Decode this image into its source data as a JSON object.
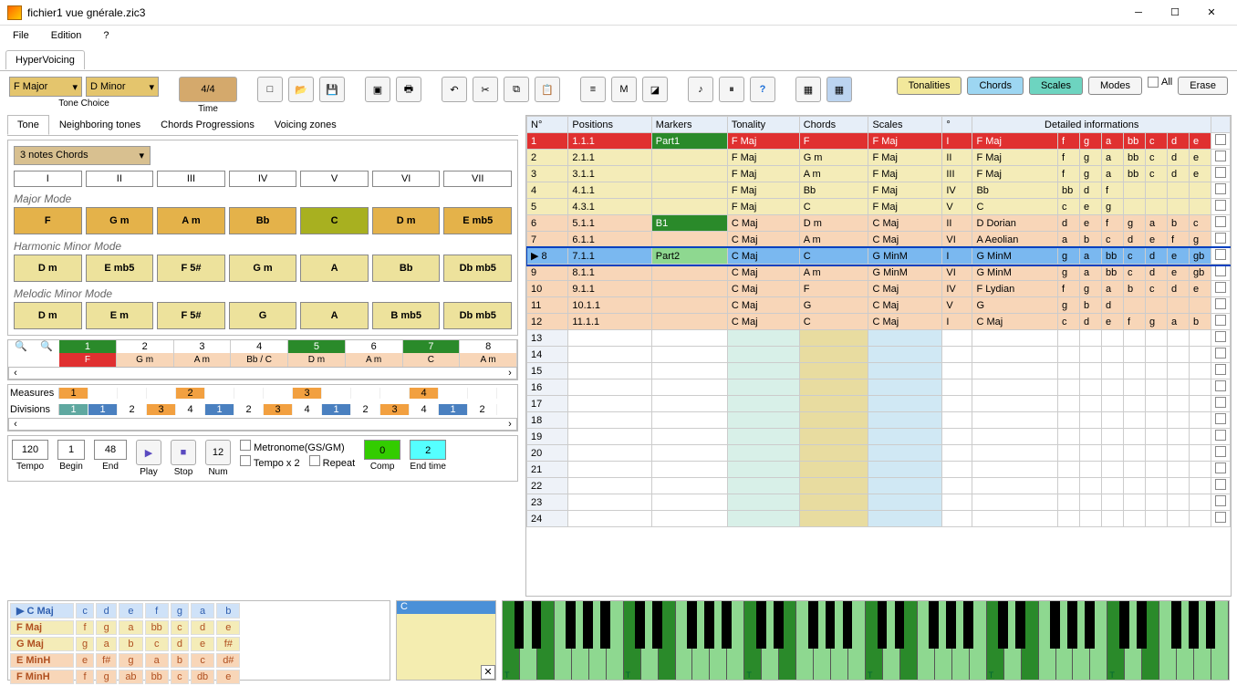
{
  "window": {
    "title": "fichier1 vue gnérale.zic3"
  },
  "menu": {
    "file": "File",
    "edition": "Edition",
    "help": "?"
  },
  "apptab": "HyperVoicing",
  "tonechoice": {
    "key": "F Major",
    "rel": "D Minor",
    "label": "Tone Choice"
  },
  "time": {
    "sig": "4/4",
    "label": "Time"
  },
  "viewbtns": {
    "tonalities": "Tonalities",
    "chords": "Chords",
    "scales": "Scales",
    "modes": "Modes",
    "all": "All",
    "erase": "Erase"
  },
  "subtabs": {
    "tone": "Tone",
    "neigh": "Neighboring tones",
    "prog": "Chords Progressions",
    "voic": "Voicing zones"
  },
  "chordsel": "3 notes Chords",
  "degrees": [
    "I",
    "II",
    "III",
    "IV",
    "V",
    "VI",
    "VII"
  ],
  "modes": {
    "major": {
      "label": "Major Mode",
      "chords": [
        "F",
        "G m",
        "A m",
        "Bb",
        "C",
        "D m",
        "E mb5"
      ],
      "highlight": 4
    },
    "harm": {
      "label": "Harmonic Minor Mode",
      "chords": [
        "D m",
        "E mb5",
        "F 5#",
        "G m",
        "A",
        "Bb",
        "Db mb5"
      ]
    },
    "mel": {
      "label": "Melodic Minor Mode",
      "chords": [
        "D m",
        "E m",
        "F 5#",
        "G",
        "A",
        "B mb5",
        "Db mb5"
      ]
    }
  },
  "track": {
    "nums": [
      "1",
      "2",
      "3",
      "4",
      "5",
      "6",
      "7",
      "8"
    ],
    "hl": [
      0,
      4,
      6
    ],
    "chords": [
      "F",
      "G m",
      "A m",
      "Bb / C",
      "D m",
      "A m",
      "C",
      "A m"
    ]
  },
  "meas": {
    "label_m": "Measures",
    "label_d": "Divisions",
    "mcells": [
      "1",
      "",
      "",
      "",
      "2",
      "",
      "",
      "",
      "3",
      "",
      "",
      "",
      "4",
      "",
      ""
    ],
    "dcells": [
      "1",
      "1",
      "2",
      "3",
      "4",
      "1",
      "2",
      "3",
      "4",
      "1",
      "2",
      "3",
      "4",
      "1",
      "2"
    ],
    "mcolor": [
      true,
      false,
      false,
      false,
      true,
      false,
      false,
      false,
      true,
      false,
      false,
      false,
      true,
      false,
      false
    ]
  },
  "transport": {
    "tempo": "120",
    "tempo_l": "Tempo",
    "begin": "1",
    "begin_l": "Begin",
    "end": "48",
    "end_l": "End",
    "play_l": "Play",
    "stop_l": "Stop",
    "num": "12",
    "num_l": "Num",
    "metro": "Metronome(GS/GM)",
    "tx2": "Tempo x 2",
    "rep": "Repeat",
    "comp": "0",
    "comp_l": "Comp",
    "endtime": "2",
    "endtime_l": "End time"
  },
  "grid": {
    "headers": [
      "N°",
      "Positions",
      "Markers",
      "Tonality",
      "Chords",
      "Scales",
      "°"
    ],
    "detail_h": "Detailed informations",
    "rows": [
      {
        "n": "1",
        "pos": "1.1.1",
        "mark": "Part1",
        "mark_c": "green",
        "ton": "F Maj",
        "ch": "F",
        "sc": "F Maj",
        "deg": "I",
        "cls": "row-red",
        "d": {
          "name": "F Maj",
          "notes": [
            "f",
            "g",
            "a",
            "bb",
            "c",
            "d",
            "e"
          ],
          "c": "detail-yellow"
        }
      },
      {
        "n": "2",
        "pos": "2.1.1",
        "mark": "",
        "ton": "F Maj",
        "ch": "G m",
        "sc": "F Maj",
        "deg": "II",
        "cls": "row-cream",
        "d": {
          "name": "F Maj",
          "notes": [
            "f",
            "g",
            "a",
            "bb",
            "c",
            "d",
            "e"
          ],
          "c": "detail-yellow"
        }
      },
      {
        "n": "3",
        "pos": "3.1.1",
        "mark": "",
        "ton": "F Maj",
        "ch": "A m",
        "sc": "F Maj",
        "deg": "III",
        "cls": "row-cream",
        "d": {
          "name": "F Maj",
          "notes": [
            "f",
            "g",
            "a",
            "bb",
            "c",
            "d",
            "e"
          ],
          "c": "detail-yellow"
        }
      },
      {
        "n": "4",
        "pos": "4.1.1",
        "mark": "",
        "ton": "F Maj",
        "ch": "Bb",
        "sc": "F Maj",
        "deg": "IV",
        "cls": "row-cream",
        "d": {
          "name": "Bb",
          "notes": [
            "bb",
            "d",
            "f",
            "",
            "",
            "",
            ""
          ],
          "c": "detail-blue"
        }
      },
      {
        "n": "5",
        "pos": "4.3.1",
        "mark": "",
        "ton": "F Maj",
        "ch": "C",
        "sc": "F Maj",
        "deg": "V",
        "cls": "row-cream",
        "d": {
          "name": "C",
          "notes": [
            "c",
            "e",
            "g",
            "",
            "",
            "",
            ""
          ],
          "c": "detail-blue"
        }
      },
      {
        "n": "6",
        "pos": "5.1.1",
        "mark": "B1",
        "mark_c": "green",
        "ton": "C Maj",
        "ch": "D m",
        "sc": "C Maj",
        "deg": "II",
        "cls": "row-peach",
        "d": {
          "name": "D Dorian",
          "notes": [
            "d",
            "e",
            "f",
            "g",
            "a",
            "b",
            "c"
          ],
          "c": ""
        }
      },
      {
        "n": "7",
        "pos": "6.1.1",
        "mark": "",
        "ton": "C Maj",
        "ch": "A m",
        "sc": "C Maj",
        "deg": "VI",
        "cls": "row-peach",
        "d": {
          "name": "A Aeolian",
          "notes": [
            "a",
            "b",
            "c",
            "d",
            "e",
            "f",
            "g"
          ],
          "c": ""
        }
      },
      {
        "n": "8",
        "pos": "7.1.1",
        "mark": "Part2",
        "mark_c": "lgreen",
        "ton": "C Maj",
        "ch": "C",
        "sc": "G MinM",
        "deg": "I",
        "cls": "row-blue",
        "sel": true,
        "d": {
          "name": "G MinM",
          "notes": [
            "g",
            "a",
            "bb",
            "c",
            "d",
            "e",
            "gb"
          ],
          "c": "detail-teal"
        }
      },
      {
        "n": "9",
        "pos": "8.1.1",
        "mark": "",
        "ton": "C Maj",
        "ch": "A m",
        "sc": "G MinM",
        "deg": "VI",
        "cls": "row-peach",
        "d": {
          "name": "G MinM",
          "notes": [
            "g",
            "a",
            "bb",
            "c",
            "d",
            "e",
            "gb"
          ],
          "c": "detail-teal"
        }
      },
      {
        "n": "10",
        "pos": "9.1.1",
        "mark": "",
        "ton": "C Maj",
        "ch": "F",
        "sc": "C Maj",
        "deg": "IV",
        "cls": "row-peach",
        "d": {
          "name": "F Lydian",
          "notes": [
            "f",
            "g",
            "a",
            "b",
            "c",
            "d",
            "e"
          ],
          "c": ""
        }
      },
      {
        "n": "11",
        "pos": "10.1.1",
        "mark": "",
        "ton": "C Maj",
        "ch": "G",
        "sc": "C Maj",
        "deg": "V",
        "cls": "row-peach",
        "d": {
          "name": "G",
          "notes": [
            "g",
            "b",
            "d",
            "",
            "",
            "",
            ""
          ],
          "c": "detail-ltblue"
        }
      },
      {
        "n": "12",
        "pos": "11.1.1",
        "mark": "",
        "ton": "C Maj",
        "ch": "C",
        "sc": "C Maj",
        "deg": "I",
        "cls": "row-peach",
        "d": {
          "name": "C Maj",
          "notes": [
            "c",
            "d",
            "e",
            "f",
            "g",
            "a",
            "b"
          ],
          "c": "detail-teal"
        }
      }
    ],
    "empty": [
      "13",
      "14",
      "15",
      "16",
      "17",
      "18",
      "19",
      "20",
      "21",
      "22",
      "23",
      "24"
    ]
  },
  "scales": [
    {
      "name": "C Maj",
      "notes": [
        "c",
        "d",
        "e",
        "f",
        "g",
        "a",
        "b"
      ],
      "cls": "sc-blue"
    },
    {
      "name": "F Maj",
      "notes": [
        "f",
        "g",
        "a",
        "bb",
        "c",
        "d",
        "e"
      ],
      "cls": "sc-yel"
    },
    {
      "name": "G Maj",
      "notes": [
        "g",
        "a",
        "b",
        "c",
        "d",
        "e",
        "f#"
      ],
      "cls": "sc-yel"
    },
    {
      "name": "E MinH",
      "notes": [
        "e",
        "f#",
        "g",
        "a",
        "b",
        "c",
        "d#"
      ],
      "cls": "sc-or"
    },
    {
      "name": "F MinH",
      "notes": [
        "f",
        "g",
        "ab",
        "bb",
        "c",
        "db",
        "e"
      ],
      "cls": "sc-or"
    }
  ],
  "note": {
    "title": "C"
  },
  "piano_t": "T"
}
